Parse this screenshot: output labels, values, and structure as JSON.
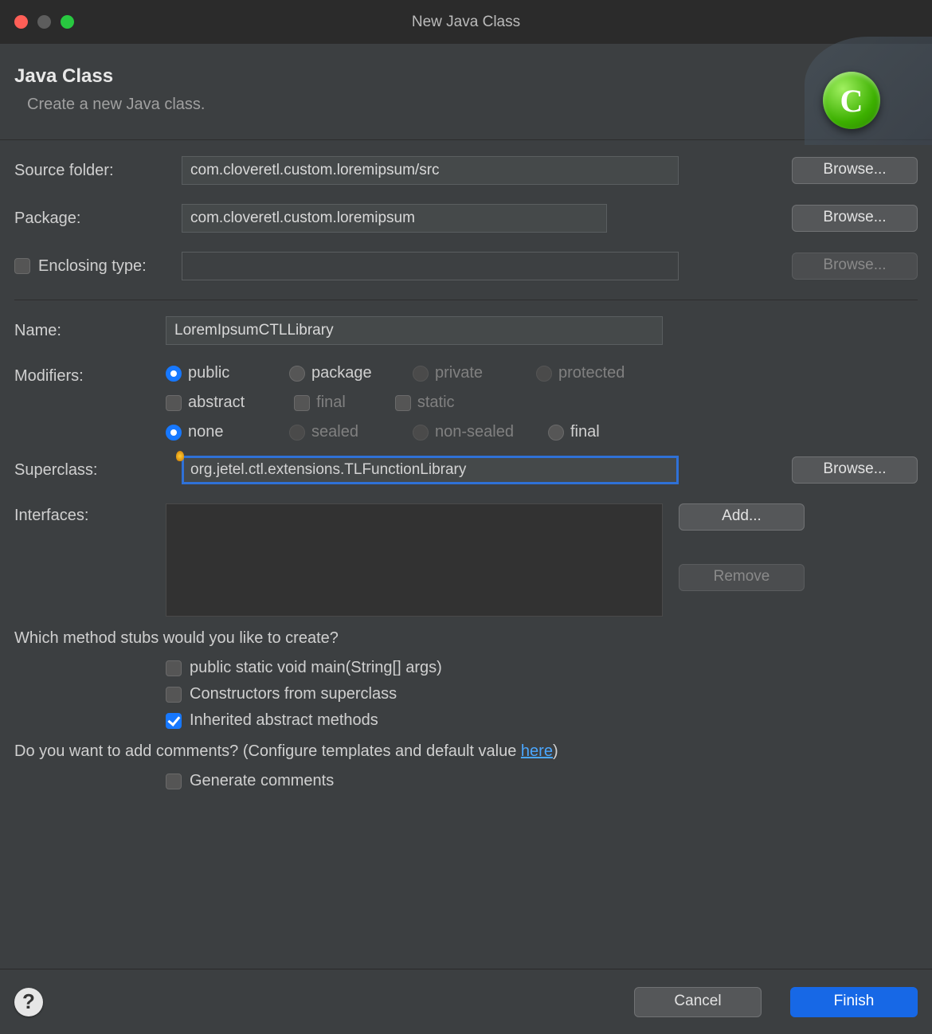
{
  "window": {
    "title": "New Java Class"
  },
  "header": {
    "title": "Java Class",
    "subtitle": "Create a new Java class.",
    "icon_letter": "C"
  },
  "labels": {
    "source_folder": "Source folder:",
    "package": "Package:",
    "enclosing": "Enclosing type:",
    "name": "Name:",
    "modifiers": "Modifiers:",
    "superclass": "Superclass:",
    "interfaces": "Interfaces:",
    "stubs_prompt": "Which method stubs would you like to create?",
    "comments_prompt_1": "Do you want to add comments? (Configure templates and default value ",
    "comments_link": "here",
    "comments_prompt_2": ")"
  },
  "fields": {
    "source_folder": "com.cloveretl.custom.loremipsum/src",
    "package": "com.cloveretl.custom.loremipsum",
    "enclosing": "",
    "name": "LoremIpsumCTLLibrary",
    "superclass": "org.jetel.ctl.extensions.TLFunctionLibrary"
  },
  "modifiers": {
    "access": [
      "public",
      "package",
      "private",
      "protected"
    ],
    "access_selected": "public",
    "access_disabled": [
      "private",
      "protected"
    ],
    "flags": [
      "abstract",
      "final",
      "static"
    ],
    "flags_disabled": [
      "final",
      "static"
    ],
    "sealed": [
      "none",
      "sealed",
      "non-sealed",
      "final"
    ],
    "sealed_selected": "none",
    "sealed_disabled": [
      "sealed",
      "non-sealed"
    ]
  },
  "stubs": {
    "main": "public static void main(String[] args)",
    "constructors": "Constructors from superclass",
    "inherited": "Inherited abstract methods",
    "generate_comments": "Generate comments"
  },
  "buttons": {
    "browse": "Browse...",
    "add": "Add...",
    "remove": "Remove",
    "cancel": "Cancel",
    "finish": "Finish"
  }
}
